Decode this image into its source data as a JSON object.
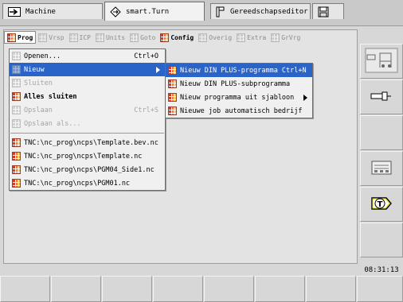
{
  "tabs": [
    {
      "label": "Machine",
      "icon": "machine-arrow-icon"
    },
    {
      "label": "smart.Turn",
      "icon": "diamond-arrows-icon"
    },
    {
      "label": "Gereedschapseditor",
      "icon": "tool-editor-icon"
    },
    {
      "label": "",
      "icon": "save-disk-icon"
    }
  ],
  "menubar": [
    {
      "label": "Prog",
      "active": true
    },
    {
      "label": "Vrsp"
    },
    {
      "label": "ICP"
    },
    {
      "label": "Units"
    },
    {
      "label": "Goto"
    },
    {
      "label": "Config",
      "active": true
    },
    {
      "label": "Overig"
    },
    {
      "label": "Extra"
    },
    {
      "label": "GrVrg"
    }
  ],
  "prog_menu": {
    "items": [
      {
        "label": "Openen...",
        "shortcut": "Ctrl+O"
      },
      {
        "label": "Nieuw",
        "highlighted": true,
        "submenu": true
      },
      {
        "label": "Sluiten",
        "disabled": true
      },
      {
        "label": "Alles sluiten",
        "bold": true
      },
      {
        "label": "Opslaan",
        "shortcut": "Ctrl+S",
        "disabled": true
      },
      {
        "label": "Opslaan als...",
        "disabled": true
      }
    ],
    "recent": [
      "TNC:\\nc_prog\\ncps\\Template.bev.nc",
      "TNC:\\nc_prog\\ncps\\Template.nc",
      "TNC:\\nc_prog\\ncps\\PGM04_Side1.nc",
      "TNC:\\nc_prog\\ncps\\PGM01.nc"
    ]
  },
  "new_submenu": [
    {
      "label": "Nieuw DIN PLUS-programma Ctrl+N",
      "highlighted": true
    },
    {
      "label": "Nieuw DIN PLUS-subprogramma"
    },
    {
      "label": "Nieuw programma uit sjabloon",
      "submenu": true
    },
    {
      "label": "Nieuwe job automatisch bedrijf"
    }
  ],
  "softkeys": {
    "right": [
      "machine-layout-icon",
      "tool-holder-icon",
      "",
      "",
      "tool-list-icon",
      "t-tool-icon",
      ""
    ]
  },
  "clock": "08:31:13"
}
